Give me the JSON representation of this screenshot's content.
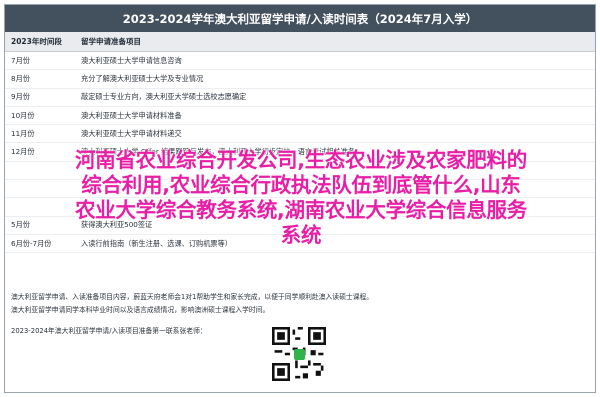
{
  "title": "2023-2024学年澳大利亚留学申请/入读时间表（2024年7月入学）",
  "headers": {
    "period": "2023年时间段",
    "items": "留学申请准备项目"
  },
  "rows": [
    {
      "period": "7月份",
      "item": "澳大利亚硕士大学申请信息咨询"
    },
    {
      "period": "8月份",
      "item": "充分了解澳大利亚硕士大学及专业情况"
    },
    {
      "period": "9月份",
      "item": "敲定硕士专业方向，澳大利亚大学硕士选校志愿确定"
    },
    {
      "period": "10月份",
      "item": "澳大利亚硕士大学申请材料准备"
    },
    {
      "period": "11月份",
      "item": "澳大利亚硕士大学申请材料递交"
    },
    {
      "period": "12月份",
      "item": "澳大利亚硕士大学 Offer 结果跟踪与发布，澳大利亚大学初步定校，语言考试相关准备"
    },
    {
      "period": "",
      "item": ""
    },
    {
      "period": "",
      "item": ""
    },
    {
      "period": "",
      "item": ""
    },
    {
      "period": "5月份",
      "item": "获得澳大利亚500签证"
    },
    {
      "period": "6月份-7月份",
      "item": "入读行前指南（新生注册、选课、订购机票等）"
    }
  ],
  "notes": [
    "澳大利亚留学申请、入读准备项目内容，蔚蓝天府老师会1对1帮助学生和家长完成，以便于同学顺利赴澳入读硕士课程。",
    "澳大利亚留学申请同学本科毕业时间以及语言成绩情况，影响澳洲硕士课程入学时间。",
    "2023-2024年澳大利亚留学申请/入读项目准备第一联系张老师："
  ],
  "overlay": [
    "河南省农业综合开发公司,生态农业涉及农家肥料的",
    "综合利用,农业综合行政执法队伍到底管什么,山东",
    "农业大学综合教务系统,湖南农业大学综合信息服务",
    "系统"
  ],
  "colors": {
    "title_bg": "#43505e",
    "overlay_text": "#e81fa6"
  }
}
